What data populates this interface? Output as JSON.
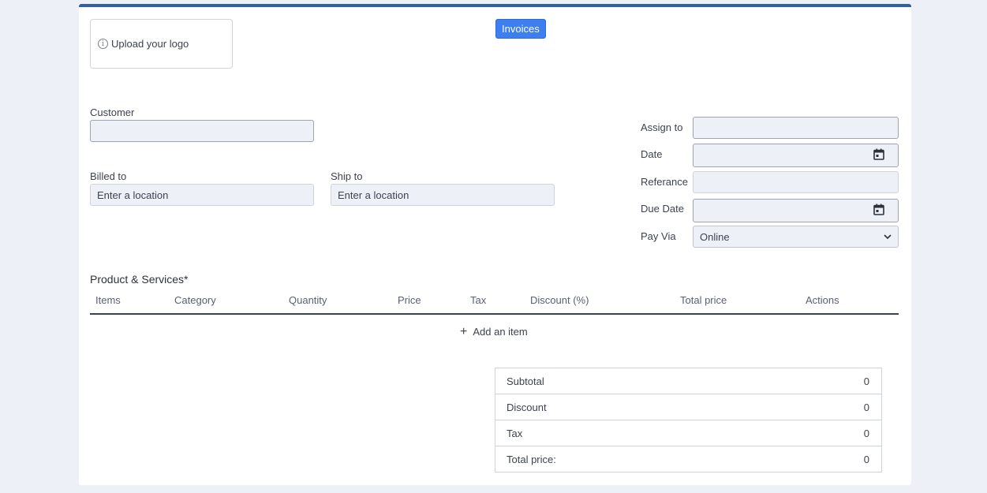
{
  "header": {
    "upload_logo_label": "Upload your logo",
    "invoices_button": "Invoices"
  },
  "customer": {
    "label": "Customer",
    "value": ""
  },
  "billed_to": {
    "label": "Billed to",
    "placeholder": "Enter a location"
  },
  "ship_to": {
    "label": "Ship to",
    "placeholder": "Enter a location"
  },
  "right_form": {
    "assign_to": {
      "label": "Assign to",
      "value": ""
    },
    "date": {
      "label": "Date",
      "value": ""
    },
    "referance": {
      "label": "Referance",
      "value": ""
    },
    "due_date": {
      "label": "Due Date",
      "value": ""
    },
    "pay_via": {
      "label": "Pay Via",
      "selected": "Online"
    }
  },
  "products": {
    "title": "Product & Services*",
    "columns": [
      "Items",
      "Category",
      "Quantity",
      "Price",
      "Tax",
      "Discount (%)",
      "Total price",
      "Actions"
    ],
    "add_item_label": "Add an item"
  },
  "totals": [
    {
      "label": "Subtotal",
      "value": "0"
    },
    {
      "label": "Discount",
      "value": "0"
    },
    {
      "label": "Tax",
      "value": "0"
    },
    {
      "label": "Total price:",
      "value": "0"
    }
  ],
  "icons": {
    "info": "info-icon",
    "calendar": "calendar-icon",
    "chevron": "chevron-down-icon",
    "plus": "plus-icon"
  },
  "colors": {
    "accent": "#3d7ef0",
    "top_border": "#2f5fa8",
    "background": "#eef0f8"
  }
}
